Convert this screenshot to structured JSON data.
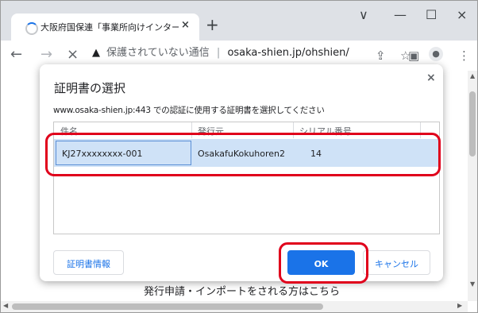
{
  "browser": {
    "tab_title": "大阪府国保連「事業所向けインター",
    "tab_close": "×",
    "new_tab": "+",
    "win_menu": "∨",
    "win_min": "—",
    "win_max": "☐",
    "win_close": "×",
    "back": "←",
    "forward": "→",
    "stop": "×",
    "security_icon": "▲",
    "security_text": "保護されていない通信",
    "separator": "|",
    "url": "osaka-shien.jp/ohshien/",
    "share_icon": "⇪",
    "star_icon": "☆",
    "sidepanel_icon": "▣",
    "profile_icon": "●",
    "menu_icon": "⋮"
  },
  "page": {
    "bottom_text": "発行申請・インポートをされる方はこちら"
  },
  "dialog": {
    "title": "証明書の選択",
    "close": "×",
    "description": "www.osaka-shien.jp:443 での認証に使用する証明書を選択してください",
    "columns": [
      "件名",
      "発行元",
      "シリアル番号"
    ],
    "rows": [
      {
        "subject": "KJ27xxxxxxxx-001",
        "issuer": "OsakafuKokuhoren2",
        "serial": "14"
      }
    ],
    "cert_info_button": "証明書情報",
    "ok_button": "OK",
    "cancel_button": "キャンセル"
  },
  "colors": {
    "accent": "#1a73e8",
    "highlight": "#e0001b",
    "selection": "#cfe2f7"
  }
}
